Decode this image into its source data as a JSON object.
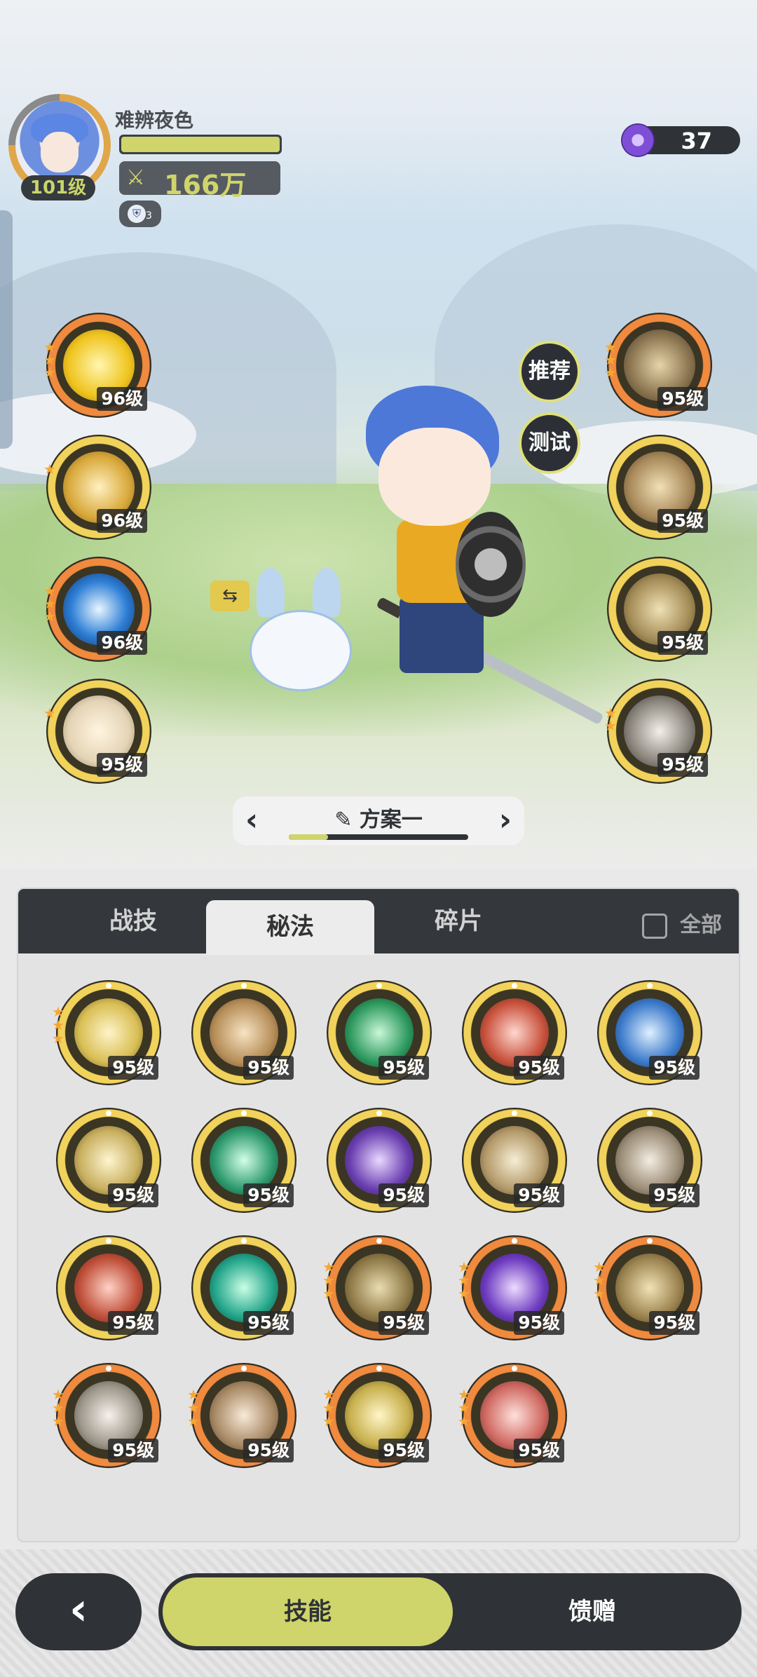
{
  "player": {
    "name": "难辨夜色",
    "level": "101级",
    "power": "166万",
    "shield_count": "3",
    "hp_fraction": 1.0
  },
  "currency": {
    "amount": "37",
    "icon": "purple-gem-icon"
  },
  "scene_buttons": {
    "recommend": "推荐",
    "test": "测试"
  },
  "left_skills": [
    {
      "level": "96级",
      "stars": 3,
      "ring": "orange",
      "icon": "golden-arrow-up-icon"
    },
    {
      "level": "96级",
      "stars": 1,
      "ring": "gold",
      "icon": "golden-rune-icon"
    },
    {
      "level": "96级",
      "stars": 3,
      "ring": "orange",
      "icon": "blue-vortex-icon"
    },
    {
      "level": "95级",
      "stars": 1,
      "ring": "gold",
      "icon": "burst-rune-icon"
    }
  ],
  "right_skills": [
    {
      "level": "95级",
      "stars": 3,
      "ring": "orange",
      "icon": "fist-icon"
    },
    {
      "level": "95级",
      "stars": 0,
      "ring": "gold",
      "icon": "claw-strike-icon"
    },
    {
      "level": "95级",
      "stars": 0,
      "ring": "gold",
      "icon": "golem-icon"
    },
    {
      "level": "95级",
      "stars": 2,
      "ring": "gold",
      "icon": "spiral-strike-icon"
    }
  ],
  "plan": {
    "label": "方案一",
    "progress": 0.22
  },
  "tabs": [
    {
      "label": "战技",
      "active": false
    },
    {
      "label": "秘法",
      "active": true
    },
    {
      "label": "碎片",
      "active": false
    }
  ],
  "filter_all_label": "全部",
  "grid_skills": [
    {
      "level": "95级",
      "stars": 3,
      "ring": "gold",
      "icon": "healing-figure-icon"
    },
    {
      "level": "95级",
      "stars": 0,
      "ring": "gold",
      "icon": "muscle-figure-icon"
    },
    {
      "level": "95级",
      "stars": 0,
      "ring": "gold",
      "icon": "green-cross-icon"
    },
    {
      "level": "95级",
      "stars": 0,
      "ring": "gold",
      "icon": "red-shield-icon"
    },
    {
      "level": "95级",
      "stars": 0,
      "ring": "gold",
      "icon": "blue-shield-icon"
    },
    {
      "level": "95级",
      "stars": 0,
      "ring": "gold",
      "icon": "eye-icon"
    },
    {
      "level": "95级",
      "stars": 0,
      "ring": "gold",
      "icon": "green-heart-icon"
    },
    {
      "level": "95级",
      "stars": 0,
      "ring": "gold",
      "icon": "purple-beast-icon"
    },
    {
      "level": "95级",
      "stars": 0,
      "ring": "gold",
      "icon": "sword-up-icon"
    },
    {
      "level": "95级",
      "stars": 0,
      "ring": "gold",
      "icon": "blade-icon"
    },
    {
      "level": "95级",
      "stars": 0,
      "ring": "gold",
      "icon": "red-scroll-icon"
    },
    {
      "level": "95级",
      "stars": 0,
      "ring": "gold",
      "icon": "green-sword-icon"
    },
    {
      "level": "95级",
      "stars": 3,
      "ring": "orange",
      "icon": "golden-slash-icon"
    },
    {
      "level": "95级",
      "stars": 3,
      "ring": "orange",
      "icon": "purple-horn-icon"
    },
    {
      "level": "95级",
      "stars": 3,
      "ring": "orange",
      "icon": "golden-armor-icon"
    },
    {
      "level": "95级",
      "stars": 3,
      "ring": "orange",
      "icon": "sword-aura-icon"
    },
    {
      "level": "95级",
      "stars": 3,
      "ring": "orange",
      "icon": "heart-shield-icon"
    },
    {
      "level": "95级",
      "stars": 3,
      "ring": "orange",
      "icon": "hexagon-gem-icon"
    },
    {
      "level": "95级",
      "stars": 3,
      "ring": "orange",
      "icon": "red-sword-icon"
    }
  ],
  "bottom_nav": {
    "skills": "技能",
    "gift": "馈赠",
    "back_icon": "back-arrow-icon"
  },
  "colors": {
    "accent": "#cfd46b",
    "dark": "#2f3337",
    "orange_ring": "#f08a3e",
    "gold_ring": "#f1d35c"
  }
}
